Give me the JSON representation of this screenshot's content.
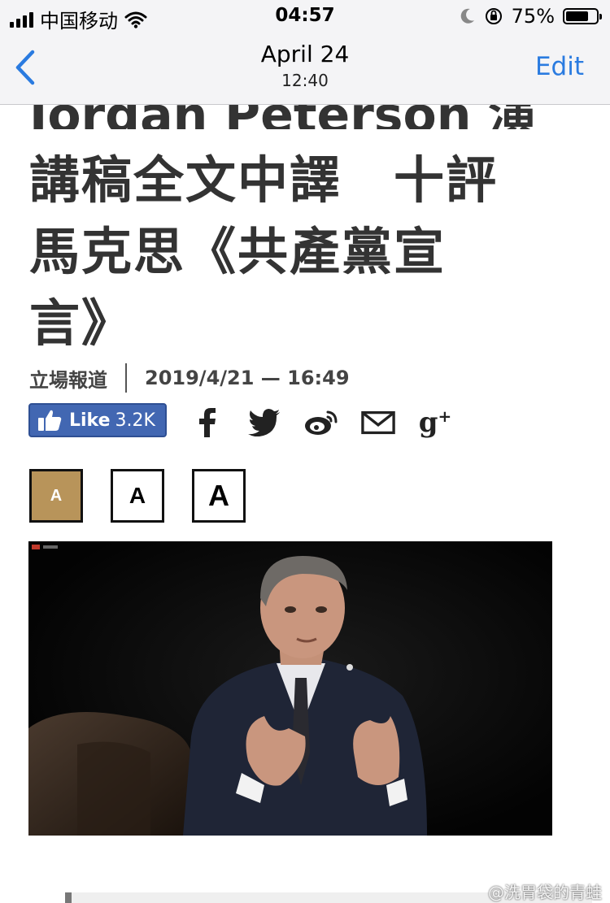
{
  "status_bar": {
    "carrier": "中国移动",
    "time": "04:57",
    "battery_percent": "75%",
    "battery_level": 0.75
  },
  "nav": {
    "back_icon": "chevron-left-icon",
    "date": "April 24",
    "time": "12:40",
    "edit_label": "Edit"
  },
  "article": {
    "headline_cut": "Jordan Peterson 演",
    "headline_lines": [
      "講稿全文中譯　十評",
      "馬克思《共產黨宣",
      "言》"
    ],
    "source": "立場報道",
    "published": "2019/4/21 — 16:49",
    "like": {
      "label": "Like",
      "count": "3.2K"
    },
    "share_icons": [
      "facebook-icon",
      "twitter-icon",
      "weibo-icon",
      "mail-icon",
      "google-plus-icon"
    ],
    "font_size_buttons": [
      {
        "label": "A",
        "active": true
      },
      {
        "label": "A",
        "active": false
      },
      {
        "label": "A",
        "active": false
      }
    ]
  },
  "watermark": "@洗胃袋的青蛙",
  "colors": {
    "link_blue": "#2a7be0",
    "facebook_blue": "#4267b2",
    "active_font_button": "#b8945a",
    "headline": "#333333"
  }
}
